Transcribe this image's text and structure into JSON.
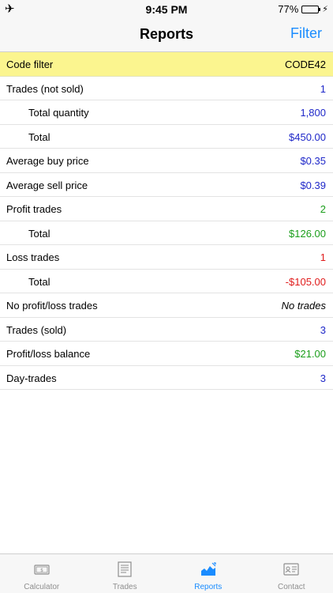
{
  "status_bar": {
    "time": "9:45 PM",
    "battery_percent": "77%",
    "battery_level": 0.77,
    "left_icon": "airplane-icon"
  },
  "nav": {
    "title": "Reports",
    "action": "Filter"
  },
  "rows": [
    {
      "label": "Code filter",
      "value": "CODE42",
      "value_color": "#000000",
      "highlight": true
    },
    {
      "label": "Trades (not sold)",
      "value": "1",
      "value_color": "#1f28c9"
    },
    {
      "label": "Total quantity",
      "value": "1,800",
      "value_color": "#1f28c9",
      "indent": true
    },
    {
      "label": "Total",
      "value": "$450.00",
      "value_color": "#1f28c9",
      "indent": true
    },
    {
      "label": "Average buy price",
      "value": "$0.35",
      "value_color": "#1f28c9"
    },
    {
      "label": "Average sell price",
      "value": "$0.39",
      "value_color": "#1f28c9"
    },
    {
      "label": "Profit trades",
      "value": "2",
      "value_color": "#1b9e1b"
    },
    {
      "label": "Total",
      "value": "$126.00",
      "value_color": "#1b9e1b",
      "indent": true
    },
    {
      "label": "Loss trades",
      "value": "1",
      "value_color": "#e01c1c"
    },
    {
      "label": "Total",
      "value": "-$105.00",
      "value_color": "#e01c1c",
      "indent": true
    },
    {
      "label": "No profit/loss trades",
      "value": "No trades",
      "value_color": "#000000",
      "italic": true
    },
    {
      "label": "Trades (sold)",
      "value": "3",
      "value_color": "#1f28c9"
    },
    {
      "label": "Profit/loss balance",
      "value": "$21.00",
      "value_color": "#1b9e1b"
    },
    {
      "label": "Day-trades",
      "value": "3",
      "value_color": "#1f28c9"
    }
  ],
  "tabs": [
    {
      "label": "Calculator",
      "icon": "calculator-icon",
      "active": false
    },
    {
      "label": "Trades",
      "icon": "document-icon",
      "active": false
    },
    {
      "label": "Reports",
      "icon": "chart-icon",
      "active": true
    },
    {
      "label": "Contact",
      "icon": "contact-card-icon",
      "active": false
    }
  ],
  "colors": {
    "accent": "#1a8cff",
    "highlight": "#fbf58f",
    "inactive_tab": "#8e8e8e"
  }
}
